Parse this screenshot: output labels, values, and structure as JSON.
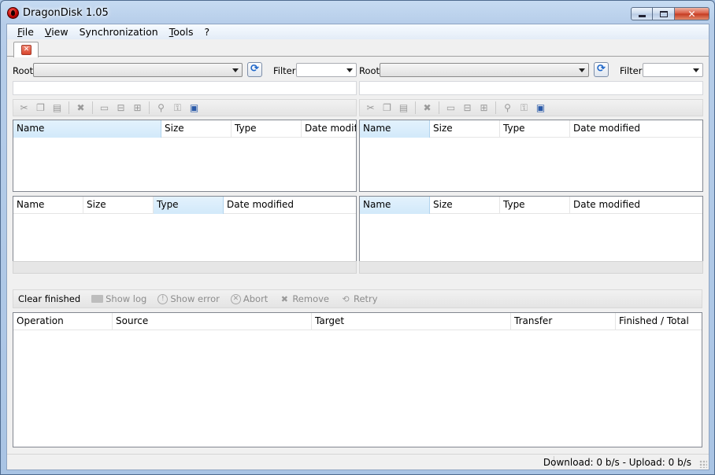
{
  "window": {
    "title": "DragonDisk 1.05",
    "icon": "dragon-disk-app-icon"
  },
  "menu": {
    "items": [
      {
        "label": "File",
        "accel": "F"
      },
      {
        "label": "View",
        "accel": "V"
      },
      {
        "label": "Synchronization",
        "accel": "S"
      },
      {
        "label": "Tools",
        "accel": "T"
      },
      {
        "label": "?",
        "accel": ""
      }
    ]
  },
  "panes": {
    "root_label": "Root",
    "filter_label": "Filter",
    "left": {
      "top_columns": [
        "Name",
        "Size",
        "Type",
        "Date modifi"
      ],
      "bottom_columns": [
        "Name",
        "Size",
        "Type",
        "Date modified"
      ]
    },
    "right": {
      "top_columns": [
        "Name",
        "Size",
        "Type",
        "Date modified"
      ],
      "bottom_columns": [
        "Name",
        "Size",
        "Type",
        "Date modified"
      ]
    }
  },
  "transfer_toolbar": {
    "clear_finished": "Clear finished",
    "show_log": "Show log",
    "show_error": "Show error",
    "abort": "Abort",
    "remove": "Remove",
    "retry": "Retry"
  },
  "transfers": {
    "columns": [
      "Operation",
      "Source",
      "Target",
      "Transfer",
      "Finished / Total"
    ]
  },
  "status": {
    "speed": "Download: 0 b/s - Upload: 0 b/s"
  },
  "colors": {
    "titlebar": "#b6cde9",
    "sorted_header": "#d2e9fa",
    "close_button": "#d7573f"
  }
}
